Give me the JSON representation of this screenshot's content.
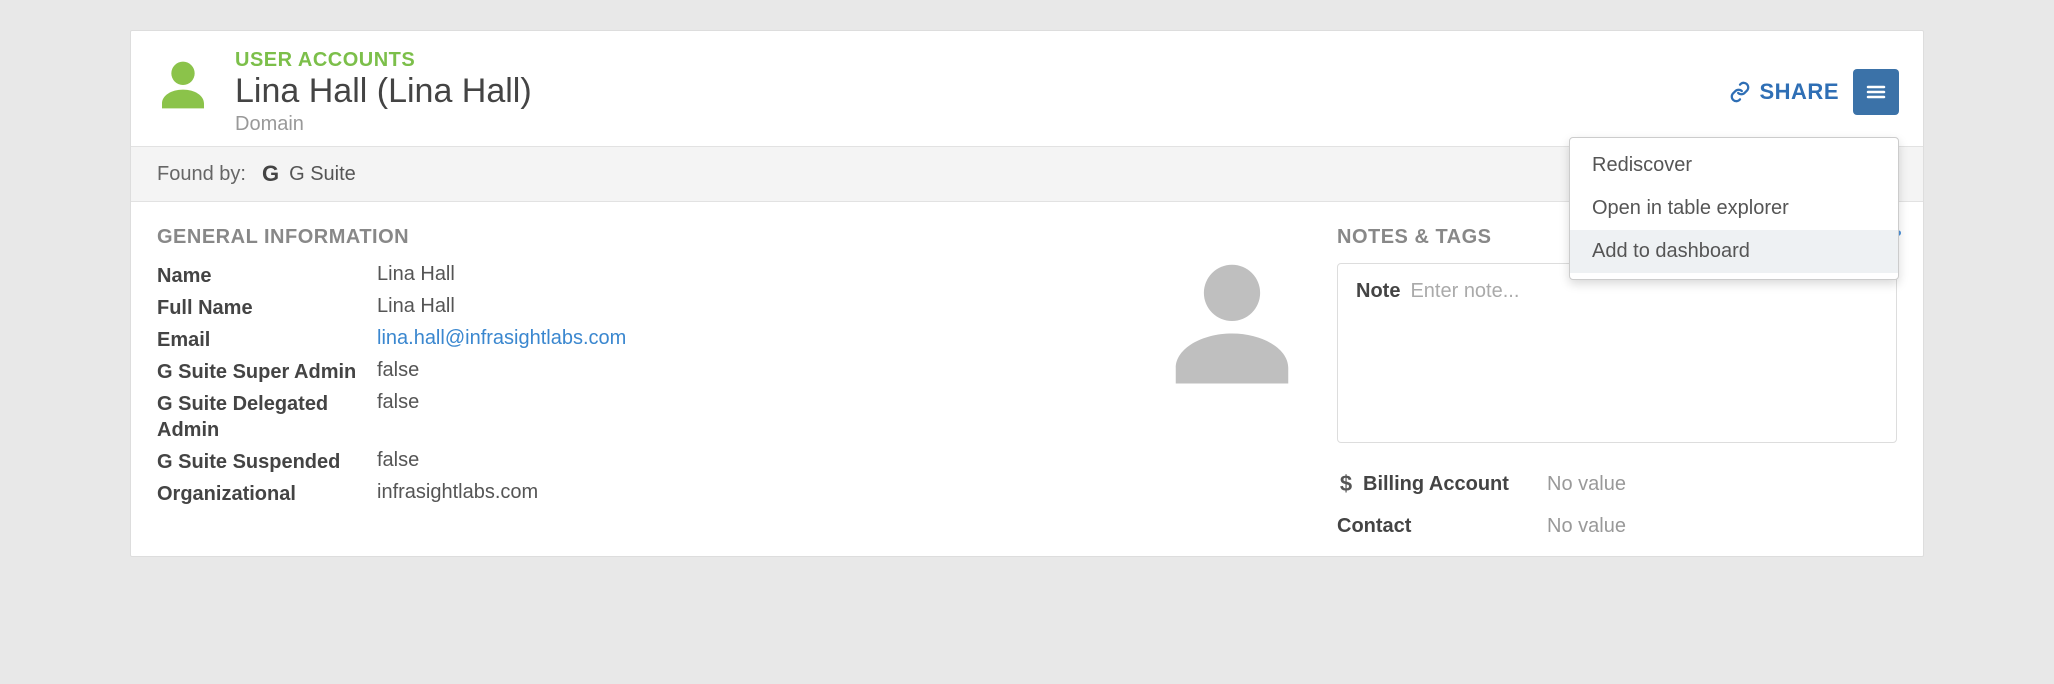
{
  "header": {
    "category": "USER ACCOUNTS",
    "title": "Lina Hall (Lina Hall)",
    "subtitle": "Domain",
    "share_label": "SHARE"
  },
  "dropdown": {
    "items": [
      {
        "label": "Rediscover"
      },
      {
        "label": "Open in table explorer"
      },
      {
        "label": "Add to dashboard"
      }
    ]
  },
  "found_by": {
    "label": "Found by:",
    "source": "G Suite"
  },
  "general": {
    "heading": "GENERAL INFORMATION",
    "rows": [
      {
        "label": "Name",
        "value": "Lina Hall",
        "link": false
      },
      {
        "label": "Full Name",
        "value": "Lina Hall",
        "link": false
      },
      {
        "label": "Email",
        "value": "lina.hall@infrasightlabs.com",
        "link": true
      },
      {
        "label": "G Suite Super Admin",
        "value": "false",
        "link": false
      },
      {
        "label": "G Suite Delegated Admin",
        "value": "false",
        "link": false
      },
      {
        "label": "G Suite Suspended",
        "value": "false",
        "link": false
      },
      {
        "label": "Organizational",
        "value": "infrasightlabs.com",
        "link": false
      }
    ]
  },
  "notes": {
    "heading": "NOTES & TAGS",
    "note_label": "Note",
    "note_placeholder": "Enter note..."
  },
  "tags": [
    {
      "icon": "dollar",
      "label": "Billing Account",
      "value": "No value"
    },
    {
      "icon": "",
      "label": "Contact",
      "value": "No value"
    }
  ]
}
